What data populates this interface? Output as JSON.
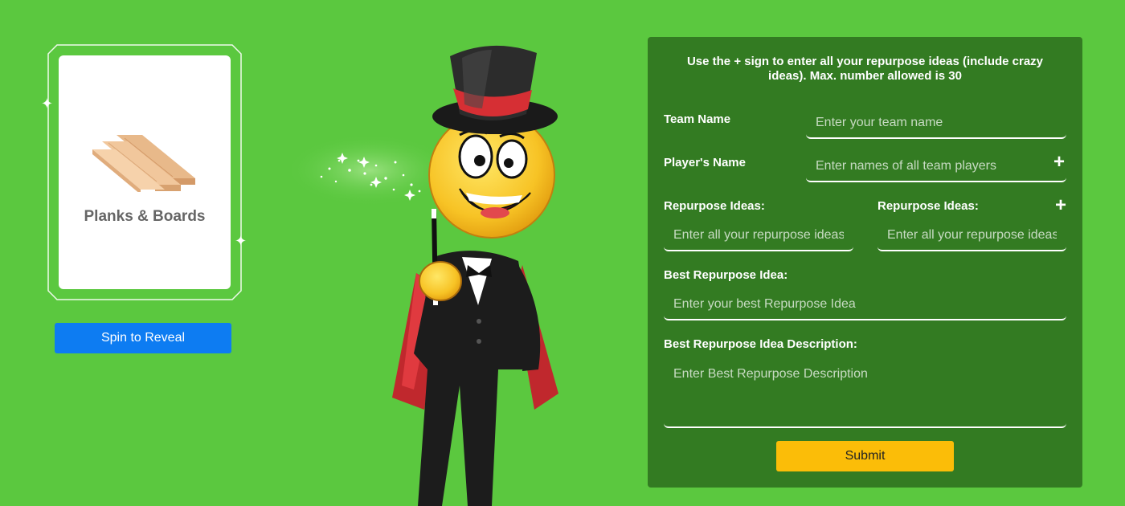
{
  "card": {
    "title": "Planks & Boards",
    "image_icon": "planks-icon",
    "sparkle_glyph": "✦"
  },
  "spin_button": {
    "label": "Spin to Reveal",
    "color": "#0d7cf2"
  },
  "form": {
    "instructions": "Use the + sign to enter all your repurpose ideas (include crazy ideas). Max. number allowed is 30",
    "team_name": {
      "label": "Team Name",
      "placeholder": "Enter your team name",
      "value": ""
    },
    "players": {
      "label": "Player's Name",
      "placeholder": "Enter names of all team players",
      "value": "",
      "add_glyph": "+"
    },
    "ideas_left": {
      "label": "Repurpose Ideas:",
      "placeholder": "Enter all your repurpose ideas",
      "value": ""
    },
    "ideas_right": {
      "label": "Repurpose Ideas:",
      "placeholder": "Enter all your repurpose ideas",
      "value": "",
      "add_glyph": "+"
    },
    "best_idea": {
      "label": "Best Repurpose Idea:",
      "placeholder": "Enter your best Repurpose Idea",
      "value": ""
    },
    "best_description": {
      "label": "Best Repurpose Idea Description:",
      "placeholder": "Enter Best Repurpose Description",
      "value": ""
    },
    "submit_label": "Submit",
    "submit_color": "#fbbd08"
  },
  "colors": {
    "page_background": "#5bc83f",
    "panel_background": "#337b22",
    "card_background": "#ffffff"
  }
}
